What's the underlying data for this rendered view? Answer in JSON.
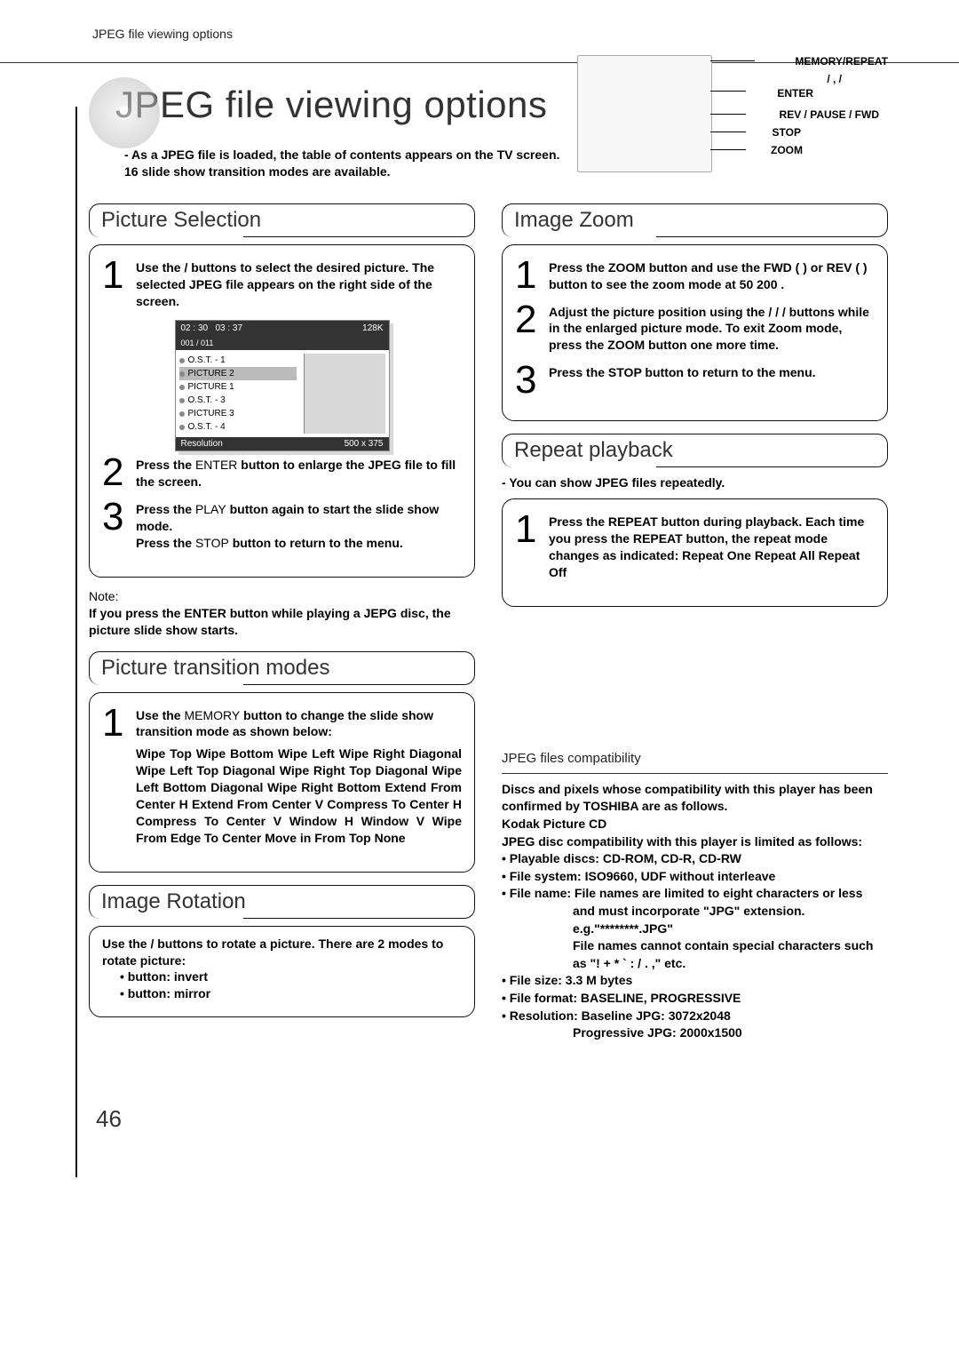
{
  "runhead": "JPEG file viewing options",
  "hero": {
    "title": "JPEG file viewing options",
    "sub": "- As a JPEG file is loaded, the table of contents appears on the TV screen. 16 slide show transition modes are available."
  },
  "remote": {
    "memory": "MEMORY/REPEAT",
    "nav": "   /   ,   /",
    "enter": "ENTER",
    "rev": "REV / PAUSE / FWD",
    "stop": "STOP",
    "zoom": "ZOOM"
  },
  "pictureSelection": {
    "title": "Picture Selection",
    "step1": "Use the   /   buttons to select the desired picture. The selected JPEG file appears on the right side of the screen.",
    "step2a": "Press the ",
    "step2b": "ENTER",
    "step2c": " button to enlarge the JPEG file to fill the screen.",
    "step3a": "Press the ",
    "step3b": "PLAY",
    "step3c": " button again to start the slide show mode.",
    "step3d": "Press the ",
    "step3e": "STOP",
    "step3f": " button to return to the menu.",
    "noteHead": "Note:",
    "note": "If you press the ENTER button while playing a JEPG disc, the picture slide show starts."
  },
  "toc": {
    "time1": "02 : 30",
    "time2": "03 : 37",
    "size": "128K",
    "items": [
      "O.S.T. - 1",
      "PICTURE 2",
      "PICTURE 1",
      "O.S.T. - 3",
      "PICTURE 3",
      "O.S.T. - 4"
    ],
    "counter": "001 / 011",
    "resLabel": "Resolution",
    "res": "500   x   375"
  },
  "transition": {
    "title": "Picture transition modes",
    "step1a": "Use the ",
    "step1b": "MEMORY",
    "step1c": " button to change the slide show transition mode as shown below:",
    "list": "Wipe Top   Wipe Bottom   Wipe Left   Wipe Right   Diagonal Wipe Left Top   Diagonal Wipe Right Top   Diagonal Wipe Left Bottom   Diagonal Wipe Right Bottom   Extend From Center H   Extend From Center V   Compress To Center H   Compress To Center V   Window H   Window V   Wipe From Edge To Center   Move in From Top   None"
  },
  "rotation": {
    "title": "Image Rotation",
    "lead": "Use the   /   buttons to rotate a picture. There are 2 modes to rotate picture:",
    "b1": "•      button: invert",
    "b2": "•      button: mirror"
  },
  "zoom": {
    "title": "Image Zoom",
    "s1": "Press the ZOOM button and use the FWD (    ) or REV (     ) button to see the zoom mode at 50   200   .",
    "s2": "Adjust the picture position using the  /  /  /   buttons while in the enlarged picture mode. To exit Zoom mode, press the ZOOM button one more time.",
    "s3": "Press the STOP button to return to the menu."
  },
  "repeat": {
    "title": "Repeat playback",
    "lead": "- You can show JPEG files repeatedly.",
    "s1": "Press the REPEAT  button during playback. Each time you press the REPEAT button, the repeat mode changes as indicated: Repeat One   Repeat All   Repeat Off"
  },
  "compat": {
    "heading": "JPEG files compatibility",
    "line1": "Discs and pixels whose compatibility with this player has been confirmed by TOSHIBA are as follows.",
    "kodak": "Kodak Picture CD",
    "l2": "JPEG disc compatibility with this player is limited as follows:",
    "b1": "• Playable discs: CD-ROM, CD-R, CD-RW",
    "b2": "• File system: ISO9660, UDF without interleave",
    "b3": "• File name: File names are limited to eight characters or less",
    "b3a": "and must incorporate \"JPG\" extension.",
    "b3b": "e.g.\"********.JPG\"",
    "b3c": "File names cannot contain special characters such as \"!   + *   `       :   / . ,\" etc.",
    "b4": "• File size: 3.3 M bytes",
    "b5": "• File format: BASELINE, PROGRESSIVE",
    "b6": "• Resolution: Baseline JPG: 3072x2048",
    "b6a": "Progressive JPG: 2000x1500"
  },
  "pageNumber": "46"
}
